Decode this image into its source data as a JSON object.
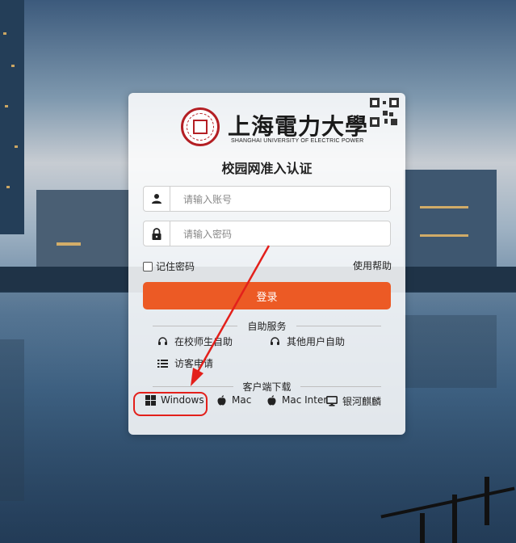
{
  "university": {
    "calligraphy": "上海電力大學",
    "english": "SHANGHAI UNIVERSITY OF ELECTRIC POWER"
  },
  "title": "校园网准入认证",
  "form": {
    "account_placeholder": "请输入账号",
    "password_placeholder": "请输入密码",
    "remember_label": "记住密码",
    "help_label": "使用帮助",
    "login_label": "登录"
  },
  "self_service": {
    "title": "自助服务",
    "items": [
      "在校师生自助",
      "其他用户自助",
      "访客申请"
    ]
  },
  "downloads": {
    "title": "客户端下载",
    "items": [
      "Windows",
      "Mac",
      "Mac Inter",
      "银河麒麟"
    ]
  },
  "colors": {
    "accent": "#ec5a25",
    "highlight": "#e3201b",
    "brand_red": "#b41f24"
  },
  "icons": {
    "user": "user-icon",
    "lock": "lock-icon",
    "qr": "qr-code-icon",
    "headset": "headset-icon",
    "list": "list-icon",
    "windows": "windows-icon",
    "apple": "apple-icon",
    "monitor": "monitor-icon"
  }
}
